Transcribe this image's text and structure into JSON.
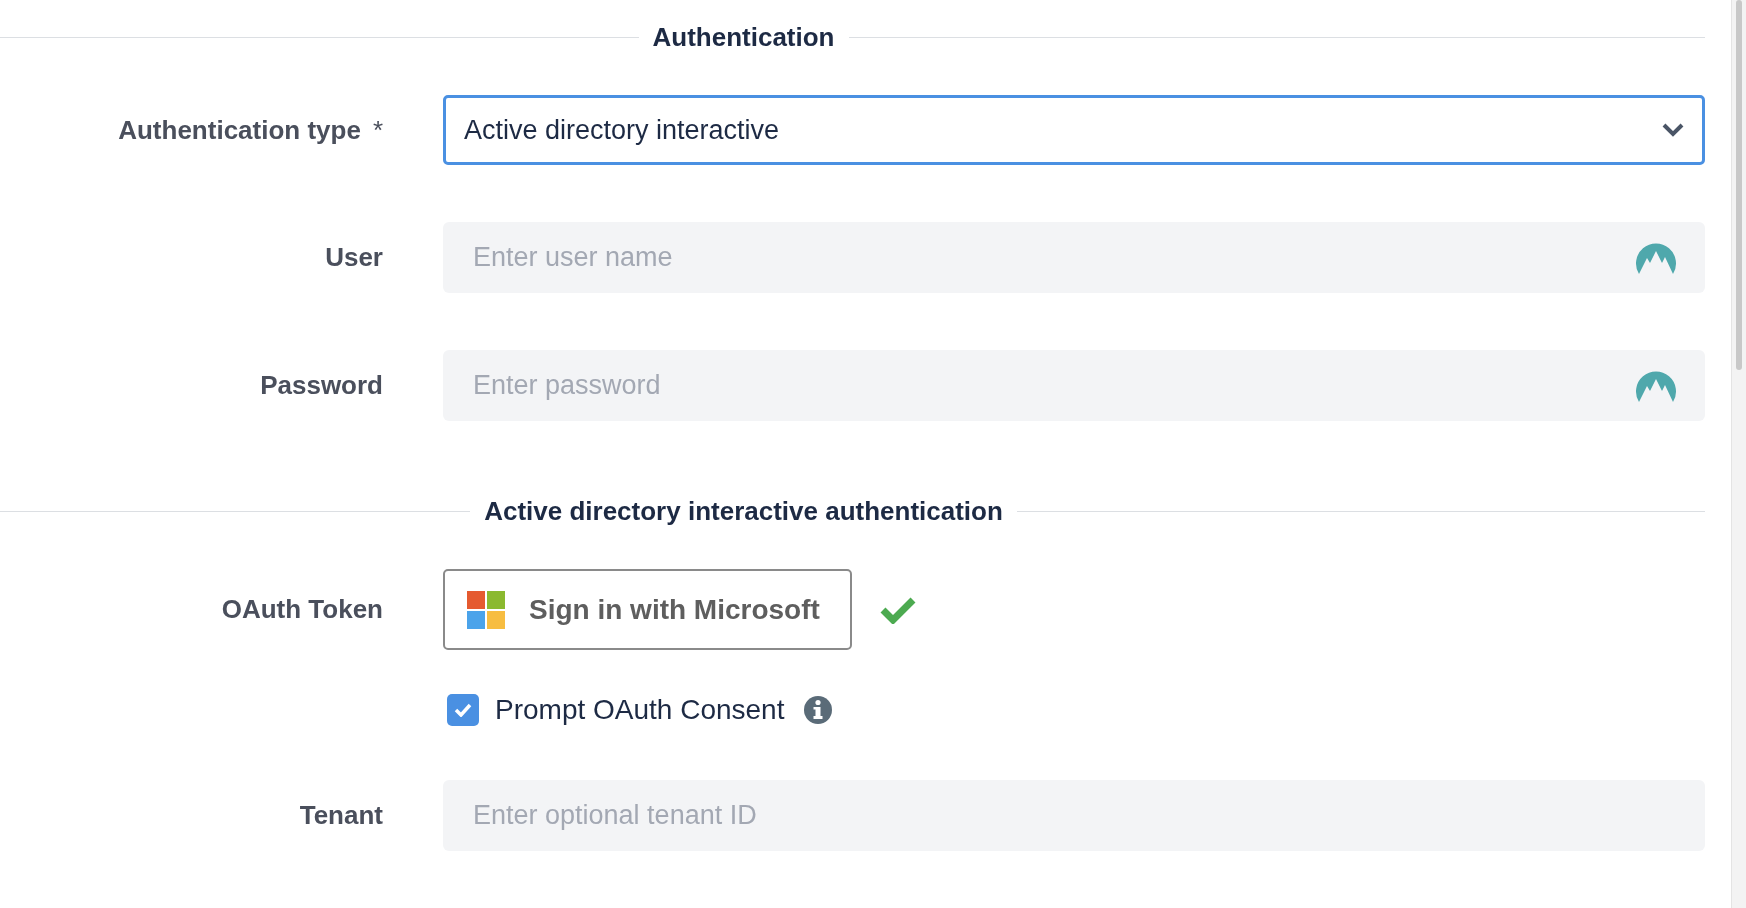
{
  "sections": [
    {
      "title": "Authentication",
      "fields": [
        {
          "kind": "select",
          "label": "Authentication type",
          "required_mark": "*",
          "value": "Active directory interactive",
          "focused": true
        },
        {
          "kind": "input",
          "label": "User",
          "placeholder": "Enter user name",
          "suffix_icon": true
        },
        {
          "kind": "input",
          "label": "Password",
          "placeholder": "Enter password",
          "suffix_icon": true
        }
      ]
    },
    {
      "title": "Active directory interactive authentication",
      "fields": [
        {
          "kind": "signin",
          "label": "OAuth Token",
          "button": "Sign in with Microsoft",
          "signed_in": true
        },
        {
          "kind": "checkbox",
          "label": "Prompt OAuth Consent",
          "checked": true,
          "info": true
        },
        {
          "kind": "input",
          "label": "Tenant",
          "placeholder": "Enter optional tenant ID",
          "suffix_icon": false
        }
      ]
    }
  ]
}
